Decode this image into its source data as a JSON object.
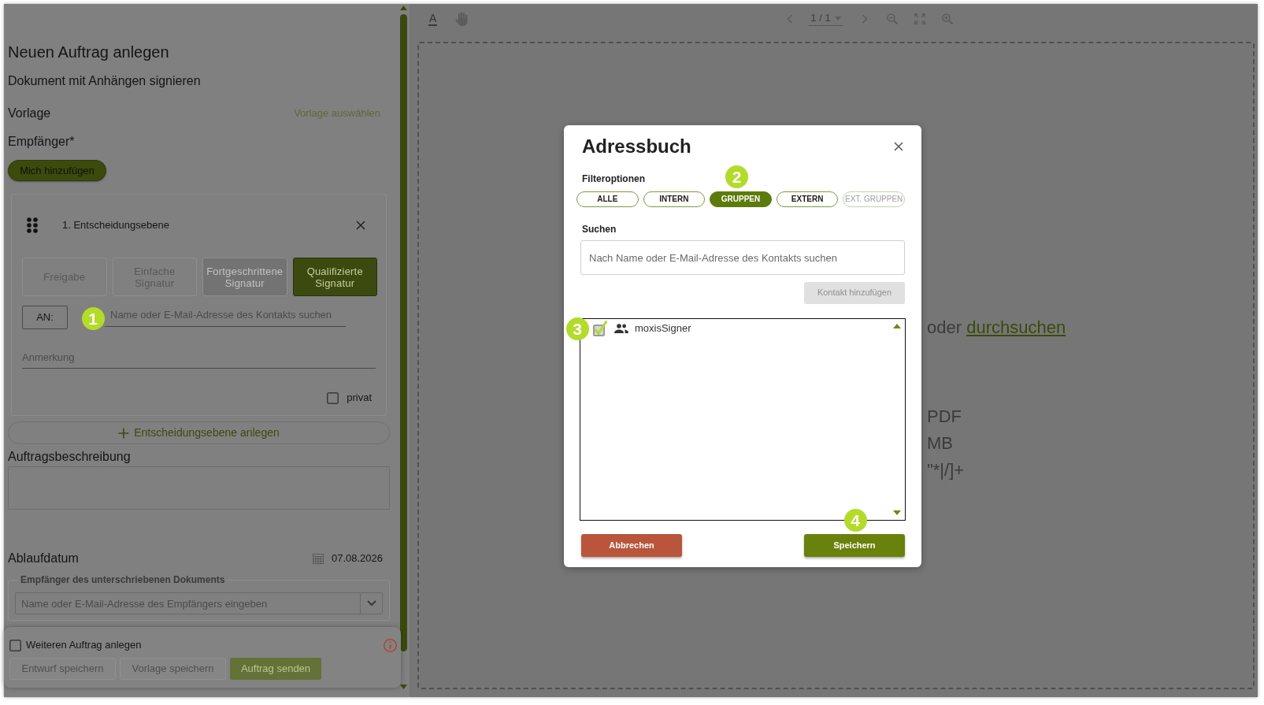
{
  "form": {
    "title": "Neuen Auftrag anlegen",
    "subtitle": "Dokument mit Anhängen signieren",
    "template": {
      "label": "Vorlage",
      "link": "Vorlage auswählen"
    },
    "recipients_label": "Empfänger*",
    "add_me_button": "Mich hinzufügen",
    "decision_levels": [
      {
        "title": "1. Entscheidungsebene",
        "signature_types": [
          {
            "label": "Freigabe",
            "selected": false,
            "disabled": false
          },
          {
            "label": "Einfache Signatur",
            "selected": false,
            "disabled": false
          },
          {
            "label": "Fortgeschrittene Signatur",
            "selected": false,
            "disabled": true
          },
          {
            "label": "Qualifizierte Signatur",
            "selected": true,
            "disabled": false
          }
        ],
        "to_label": "AN:",
        "contact_search": {
          "placeholder": "Name oder E-Mail-Adresse des Kontakts suchen",
          "callout": "1"
        },
        "note": {
          "placeholder": "Anmerkung"
        },
        "private": {
          "label": "privat",
          "checked": false
        }
      }
    ],
    "add_level_button": "Entscheidungsebene anlegen",
    "description": {
      "label": "Auftragsbeschreibung"
    },
    "expiry": {
      "label": "Ablaufdatum",
      "value": "07.08.2026"
    },
    "signed_document_recipients": {
      "legend": "Empfänger des unterschriebenen Dokuments",
      "placeholder": "Name oder E-Mail-Adresse des Empfängers eingeben"
    }
  },
  "footer": {
    "another_order": {
      "label": "Weiteren Auftrag anlegen",
      "checked": false
    },
    "buttons": [
      {
        "label": "Entwurf speichern",
        "kind": "secondary",
        "disabled": false
      },
      {
        "label": "Vorlage speichern",
        "kind": "secondary",
        "disabled": false
      },
      {
        "label": "Auftrag senden",
        "kind": "primary",
        "disabled": true
      }
    ]
  },
  "viewer": {
    "toolbar": {
      "text_tool": "A",
      "page": "1 / 1"
    },
    "drop_zone": {
      "lead": "oder",
      "link": "durchsuchen",
      "lines": [
        "PDF",
        "MB",
        "\"*|/]+"
      ]
    }
  },
  "address_book": {
    "title": "Adressbuch",
    "filter_label": "Filteroptionen",
    "filters": [
      {
        "label": "ALLE",
        "selected": false,
        "disabled": false
      },
      {
        "label": "INTERN",
        "selected": false,
        "disabled": false
      },
      {
        "label": "GRUPPEN",
        "selected": true,
        "disabled": false,
        "callout": "2"
      },
      {
        "label": "EXTERN",
        "selected": false,
        "disabled": false
      },
      {
        "label": "EXT. GRUPPEN",
        "selected": false,
        "disabled": true
      }
    ],
    "search_label": "Suchen",
    "search": {
      "placeholder": "Nach Name oder E-Mail-Adresse des Kontakts suchen"
    },
    "add_contact_button": {
      "label": "Kontakt hinzufügen",
      "disabled": true
    },
    "contacts": [
      {
        "name": "moxisSigner",
        "kind": "group",
        "checked": true,
        "callout": "3"
      }
    ],
    "cancel_button": "Abbrechen",
    "save_button": {
      "label": "Speichern",
      "callout": "4"
    }
  }
}
